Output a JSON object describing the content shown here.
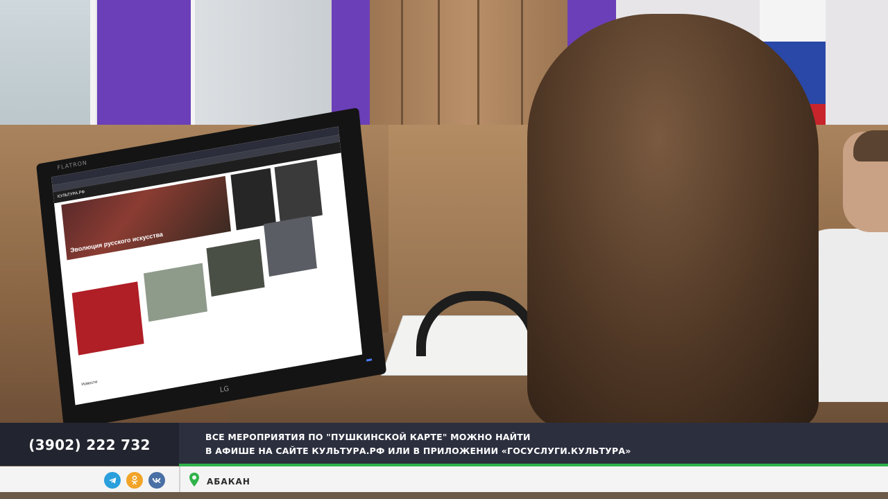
{
  "lower_third": {
    "phone": "(3902) 222 732",
    "message_line1": "ВСЕ МЕРОПРИЯТИЯ ПО \"ПУШКИНСКОЙ КАРТЕ\" МОЖНО НАЙТИ",
    "message_line2": "В АФИШЕ НА САЙТЕ КУЛЬТУРА.РФ ИЛИ В ПРИЛОЖЕНИИ «ГОСУСЛУГИ.КУЛЬТУРА»",
    "location": "АБАКАН",
    "social_icons": [
      "telegram-icon",
      "odnoklassniki-icon",
      "vk-icon"
    ],
    "accent_color": "#2fb34a"
  },
  "monitor": {
    "brand": "FLATRON",
    "maker": "LG",
    "site_logo": "КУЛЬТУРА.РФ",
    "hero_title": "Эволюция русского искусства",
    "news_label": "Новости"
  }
}
